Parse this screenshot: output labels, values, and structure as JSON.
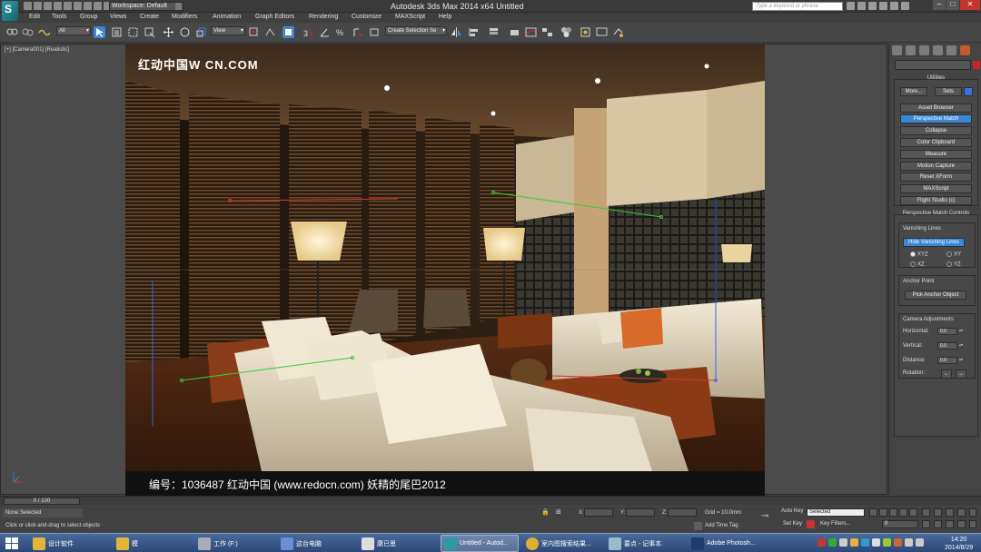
{
  "window": {
    "title": "Autodesk 3ds Max  2014 x64     Untitled",
    "workspace": "Workspace: Default",
    "search_placeholder": "Type a keyword or phrase"
  },
  "menu": [
    "Edit",
    "Tools",
    "Group",
    "Views",
    "Create",
    "Modifiers",
    "Animation",
    "Graph Editors",
    "Rendering",
    "Customize",
    "MAXScript",
    "Help"
  ],
  "toolbar": {
    "filter_dropdown": "All",
    "refcoord_dropdown": "View",
    "selection_set_dropdown": "Create Selection Se"
  },
  "viewport": {
    "label": "[+] [Camera001] [Realistic]",
    "watermark_top": "红动中国W          CN.COM",
    "watermark_bottom": "编号：1036487    红动中国 (www.redocn.com)    妖精的尾巴2012"
  },
  "command_panel": {
    "utilities_title": "Utilities",
    "more_button": "More...",
    "sets_button": "Sets",
    "utility_buttons": [
      "Asset Browser",
      "Perspective Match",
      "Collapse",
      "Color Clipboard",
      "Measure",
      "Motion Capture",
      "Reset XForm",
      "MAXScript",
      "Flight Studio (c)"
    ],
    "pm_title": "Perspective Match Controls",
    "vanishing_lines_label": "Vanishing Lines",
    "hide_vl_button": "Hide Vanishing Lines",
    "radio_options": [
      "XYZ",
      "XY",
      "XZ",
      "YZ"
    ],
    "anchor_point_label": "Anchor Point",
    "pick_anchor_button": "Pick Anchor Object",
    "camera_adj_label": "Camera Adjustments",
    "adjust_labels": [
      "Horizontal:",
      "Vertical:",
      "Distance:",
      "Rotation:"
    ],
    "adjust_values": [
      "0.0",
      "0.0",
      "0.0"
    ]
  },
  "timeline": {
    "frame_label": "0 / 100"
  },
  "status": {
    "selection": "None Selected",
    "prompt": "Click or click-and-drag to select objects",
    "grid": "Grid = 10.0mm",
    "add_time_tag": "Add Time Tag",
    "auto_key": "Auto Key",
    "set_key": "Set Key",
    "selected_dropdown": "Selected",
    "key_filters": "Key Filters...",
    "frame_field": "0"
  },
  "taskbar": {
    "items": [
      "设计软件",
      "模",
      "工作 (F:)",
      "这台电脑",
      "康已思",
      "Untitled - Autod...",
      "室内图搜索结果...",
      "要点 - 记事本",
      "Adobe Photosh..."
    ],
    "time": "14:20",
    "date": "2014/8/29"
  },
  "colors": {
    "accent_blue": "#3a87d8",
    "close_red": "#c6342b",
    "taskbar": "#2a4878"
  }
}
